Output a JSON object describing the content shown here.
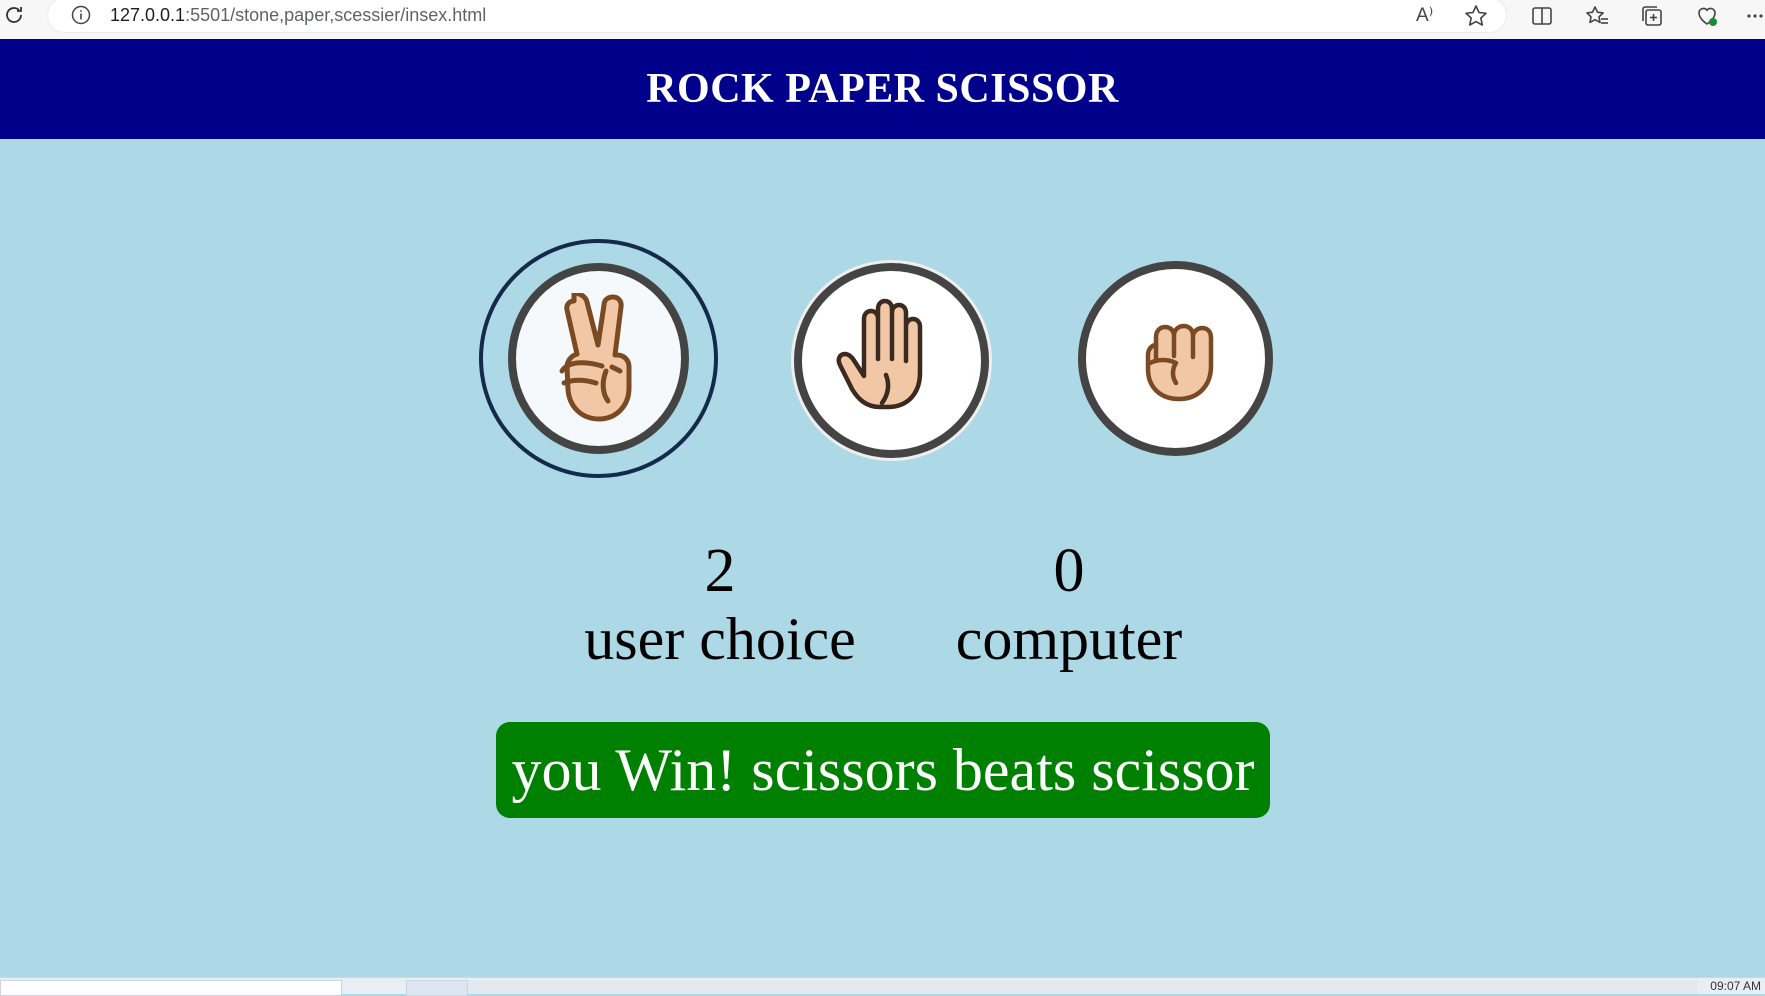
{
  "browser": {
    "url_host": "127.0.0.1",
    "url_path": ":5501/stone,paper,scessier/insex.html",
    "read_aloud_label": "A⁾",
    "icons": [
      "reload-icon",
      "info-icon",
      "read-aloud-icon",
      "favorite-star-icon",
      "split-screen-icon",
      "favorites-icon",
      "collections-icon",
      "browser-essentials-icon",
      "more-icon"
    ]
  },
  "header": {
    "title": "ROCK PAPER SCISSOR"
  },
  "choices": [
    {
      "name": "scissors",
      "icon": "scissors-hand-icon",
      "selected": true
    },
    {
      "name": "paper",
      "icon": "paper-hand-icon",
      "selected": false
    },
    {
      "name": "rock",
      "icon": "rock-fist-icon",
      "selected": false
    }
  ],
  "score": {
    "user_value": "2",
    "user_label": "user choice",
    "computer_value": "0",
    "computer_label": "computer"
  },
  "message": {
    "text": "you Win! scissors beats scissor",
    "color": "#008000"
  },
  "colors": {
    "background": "#add8e6",
    "header": "#00008b"
  },
  "taskbar": {
    "clock": "09:07 AM"
  }
}
